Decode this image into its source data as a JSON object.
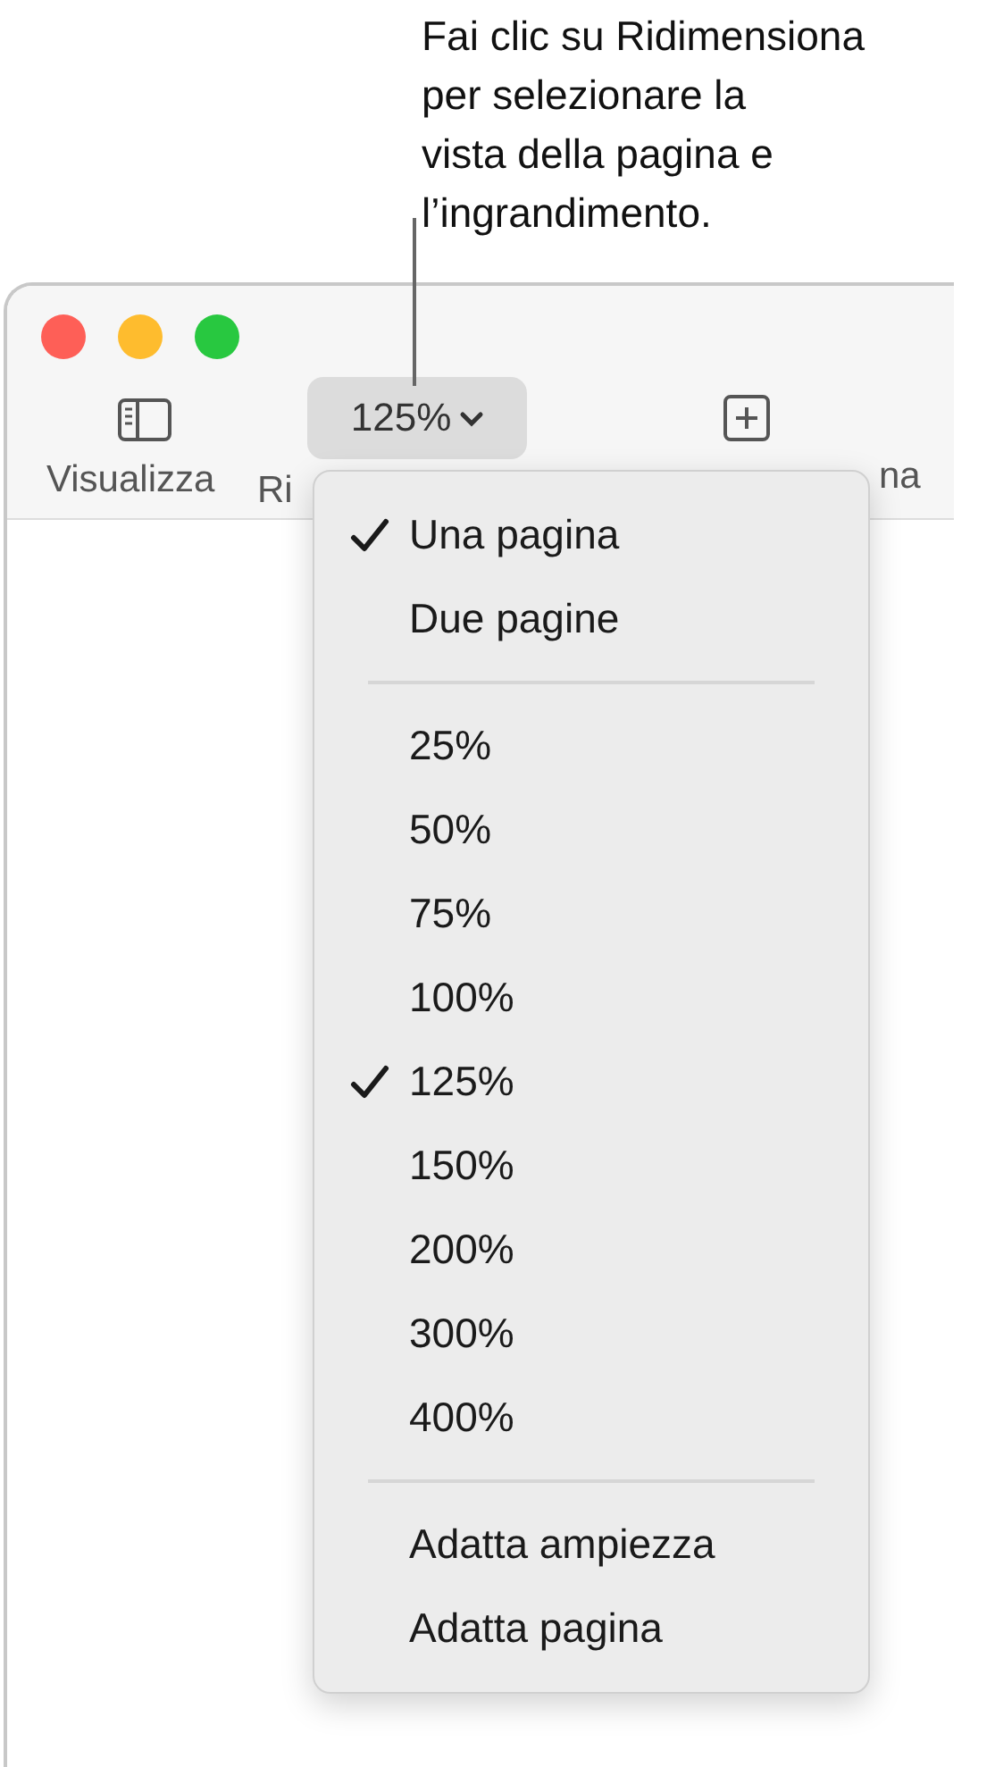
{
  "callout": {
    "lines": [
      "Fai clic su Ridimensiona",
      "per selezionare la",
      "vista della pagina e",
      "l’ingrandimento."
    ]
  },
  "window": {
    "controls": [
      {
        "color": "#fe5f57"
      },
      {
        "color": "#febc2e"
      },
      {
        "color": "#28c840"
      }
    ]
  },
  "toolbar": {
    "view": {
      "label": "Visualizza"
    },
    "zoom": {
      "value": "125%",
      "label": "Ri"
    },
    "add": {
      "label": "na"
    }
  },
  "menu": {
    "groups": [
      [
        {
          "label": "Una pagina",
          "selected": true
        },
        {
          "label": "Due pagine",
          "selected": false
        }
      ],
      [
        {
          "label": "25%",
          "selected": false
        },
        {
          "label": "50%",
          "selected": false
        },
        {
          "label": "75%",
          "selected": false
        },
        {
          "label": "100%",
          "selected": false
        },
        {
          "label": "125%",
          "selected": true
        },
        {
          "label": "150%",
          "selected": false
        },
        {
          "label": "200%",
          "selected": false
        },
        {
          "label": "300%",
          "selected": false
        },
        {
          "label": "400%",
          "selected": false
        }
      ],
      [
        {
          "label": "Adatta ampiezza",
          "selected": false
        },
        {
          "label": "Adatta pagina",
          "selected": false
        }
      ]
    ]
  }
}
